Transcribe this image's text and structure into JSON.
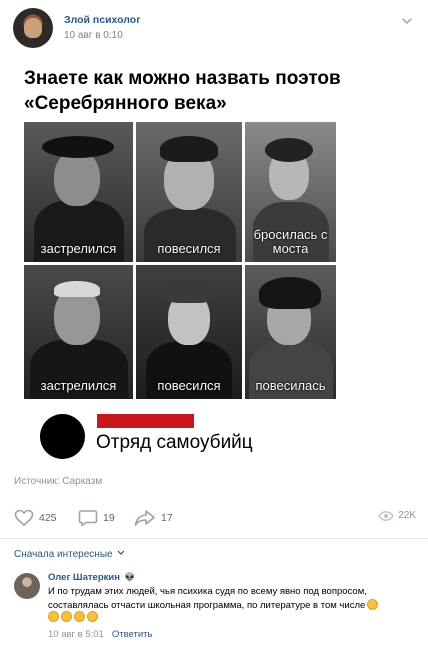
{
  "post": {
    "author": "Злой психолог",
    "date": "10 авг в 0:10",
    "meme": {
      "title": "Знаете как можно назвать поэтов «Серебрянного века»",
      "captions": [
        "застрелился",
        "повесился",
        "бросилась с моста",
        "застрелился",
        "повесился",
        "повесилась"
      ],
      "squad_text": "Отряд самоубийц"
    },
    "source": "Источник: Сарказм",
    "actions": {
      "likes": "425",
      "comments": "19",
      "shares": "17",
      "views": "22K"
    },
    "sort_label": "Сначала интересные"
  },
  "comment": {
    "author": "Олег Шатеркин",
    "text": "И по трудам этих людей, чья психика судя по всему явно под вопросом, составлялась отчасти школьная программа, по литературе в том числе",
    "date": "10 авг в 5:01",
    "reply_label": "Ответить"
  },
  "icons": {
    "menu": "chevron-down-icon",
    "like": "heart-icon",
    "comment": "comment-icon",
    "share": "share-icon",
    "views": "eye-icon",
    "author_badge": "alien-icon"
  },
  "colors": {
    "link": "#2a5885",
    "muted": "#939393",
    "red_bar": "#c8161d"
  }
}
